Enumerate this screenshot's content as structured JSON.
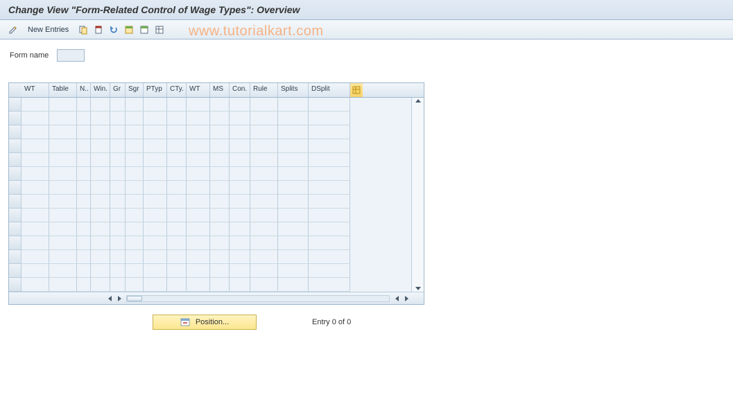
{
  "title": "Change View \"Form-Related Control of Wage Types\": Overview",
  "toolbar": {
    "new_entries_label": "New Entries"
  },
  "watermark": "www.tutorialkart.com",
  "form": {
    "label": "Form name",
    "value": ""
  },
  "grid": {
    "columns": [
      "WT",
      "Table",
      "N..",
      "Win.",
      "Gr",
      "Sgr",
      "PTyp",
      "CTy.",
      "WT",
      "MS",
      "Con.",
      "Rule",
      "Splits",
      "DSplit"
    ],
    "row_count": 14
  },
  "footer": {
    "position_label": "Position...",
    "entry_text": "Entry 0 of 0"
  }
}
